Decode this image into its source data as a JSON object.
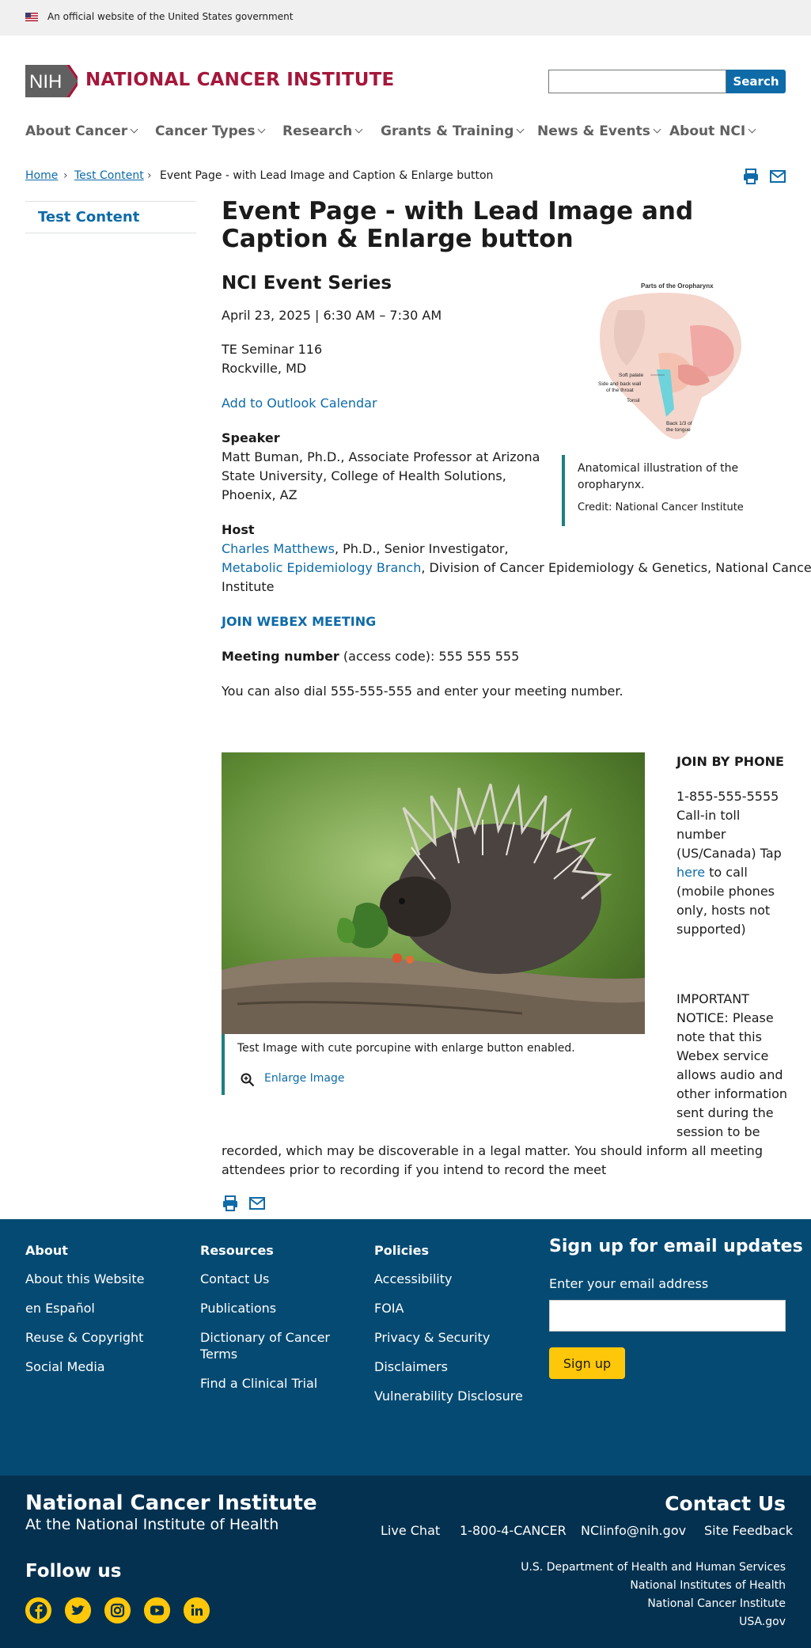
{
  "banner": {
    "text": "An official website of the United States government"
  },
  "header": {
    "logo_text": "NIH",
    "site_title": "NATIONAL CANCER INSTITUTE",
    "search_placeholder": "",
    "search_button": "Search"
  },
  "nav": {
    "items": [
      {
        "label": "About Cancer"
      },
      {
        "label": "Cancer Types"
      },
      {
        "label": "Research"
      },
      {
        "label": "Grants & Training"
      },
      {
        "label": "News & Events"
      },
      {
        "label": "About NCI"
      }
    ]
  },
  "breadcrumb": {
    "items": [
      "Home",
      "Test Content"
    ],
    "current": "Event Page - with Lead Image and Caption & Enlarge button"
  },
  "sidebar": {
    "link": "Test Content"
  },
  "event": {
    "title": "Event Page - with Lead Image and Caption & Enlarge button",
    "series": "NCI Event Series",
    "datetime": "April 23, 2025 | 6:30 AM – 7:30 AM",
    "location_line1": "TE Seminar 116",
    "location_line2": "Rockville, MD",
    "calendar_link": "Add to Outlook Calendar",
    "speaker_label": "Speaker",
    "speaker_line1": "Matt Buman, Ph.D., Associate Professor at Arizona",
    "speaker_line2": "State University, College of Health Solutions,",
    "speaker_line3": "Phoenix, AZ",
    "host_label": "Host",
    "host_name": "Charles Matthews",
    "host_title": ", Ph.D., Senior Investigator,",
    "host_branch": "Metabolic Epidemiology Branch",
    "host_division": ", Division of Cancer Epidemiology & Genetics, National Cancer",
    "host_institute": "Institute",
    "webex_link": "JOIN WEBEX MEETING",
    "meeting_label": "Meeting number",
    "meeting_value": " (access code): 555 555 555",
    "dial_text": "You can also dial 555-555-555 and enter your meeting number."
  },
  "lead_figure": {
    "diagram_title": "Parts of the Oropharynx",
    "label_soft_palate": "Soft palate",
    "label_side_wall1": "Side and back wall",
    "label_side_wall2": "of the throat",
    "label_tonsil": "Tonsil",
    "label_tongue1": "Back 1/3 of",
    "label_tongue2": "the tongue",
    "caption_line1": "Anatomical illustration of the",
    "caption_line2": "oropharynx.",
    "credit": "Credit: National Cancer Institute"
  },
  "porcupine_figure": {
    "caption": "Test Image with cute porcupine with enlarge button enabled.",
    "enlarge_label": "Enlarge Image"
  },
  "phone": {
    "heading": "JOIN BY PHONE",
    "lines": [
      "1-855-555-5555",
      "Call-in toll",
      "number",
      "(US/Canada) Tap"
    ],
    "here_link": "here",
    "after_here": " to call",
    "lines2": [
      "(mobile phones",
      "only, hosts not",
      "supported)"
    ],
    "notice_lines": [
      "IMPORTANT",
      "NOTICE: Please",
      "note that this",
      "Webex service",
      "allows audio and",
      "other information",
      "sent during the",
      "session to be"
    ],
    "notice_tail1": "recorded, which may be discoverable in a legal matter. You should inform all meeting",
    "notice_tail2": "attendees prior to recording if you intend to record the meet"
  },
  "footer": {
    "col1": {
      "heading": "About",
      "links": [
        "About this Website",
        "en Español",
        "Reuse & Copyright",
        "Social Media"
      ]
    },
    "col2": {
      "heading": "Resources",
      "links": [
        "Contact Us",
        "Publications",
        "Dictionary of Cancer",
        "Terms",
        "Find a Clinical Trial"
      ]
    },
    "col3": {
      "heading": "Policies",
      "links": [
        "Accessibility",
        "FOIA",
        "Privacy & Security",
        "Disclaimers",
        "Vulnerability Disclosure"
      ]
    },
    "signup": {
      "title": "Sign up for email updates",
      "label": "Enter your email address",
      "button": "Sign up"
    }
  },
  "footer2": {
    "title": "National Cancer Institute",
    "subtitle": "At the National Institute of Health",
    "contact_title": "Contact Us",
    "contact_links": [
      "Live Chat",
      "1-800-4-CANCER",
      "NCIinfo@nih.gov",
      "Site Feedback"
    ],
    "follow": "Follow us",
    "agencies": [
      "U.S. Department of Health and Human Services",
      "National Institutes of Health",
      "National Cancer Institute",
      "USA.gov"
    ]
  },
  "colors": {
    "nci_red": "#a5173a",
    "link_blue": "#0e6ba8",
    "footer_blue": "#054a72",
    "footer_dark": "#04314f",
    "accent_yellow": "#ffc709",
    "caption_teal": "#1f7f7f"
  }
}
